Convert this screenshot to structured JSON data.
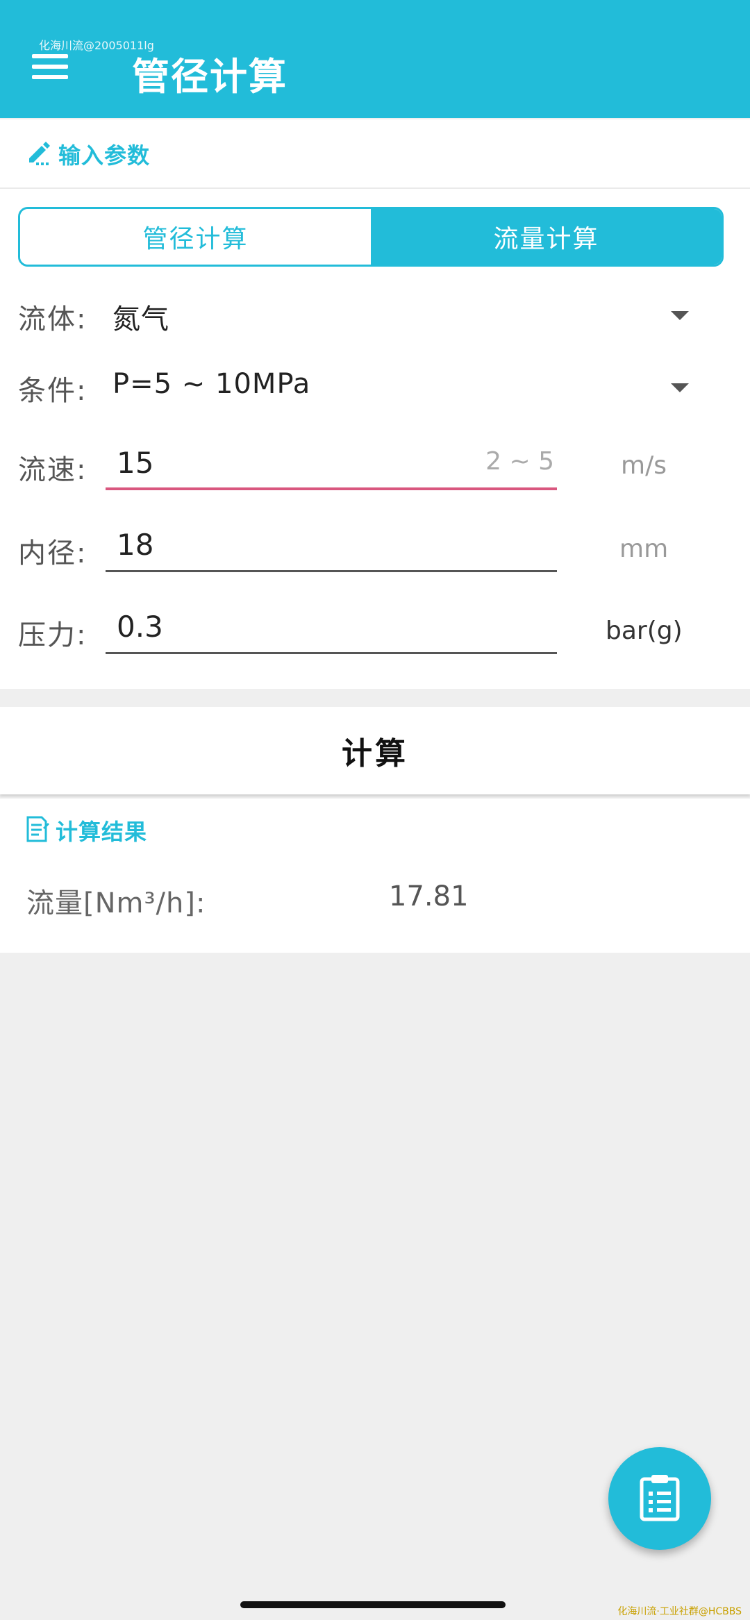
{
  "watermark_top": "化海川流@2005011lg",
  "appbar": {
    "title": "管径计算"
  },
  "input_section": {
    "title": "输入参数"
  },
  "tabs": [
    {
      "label": "管径计算",
      "selected": false
    },
    {
      "label": "流量计算",
      "selected": true
    }
  ],
  "fluid": {
    "label": "流体:",
    "value": "氮气"
  },
  "condition": {
    "label": "条件:",
    "value": "P=5 ~ 10MPa"
  },
  "velocity": {
    "label": "流速:",
    "value": "15",
    "hint": "2 ~ 5",
    "unit": "m/s"
  },
  "inner_diameter": {
    "label": "内径:",
    "value": "18",
    "unit": "mm"
  },
  "pressure": {
    "label": "压力:",
    "value": "0.3",
    "unit": "bar(g)"
  },
  "calculate_button": {
    "label": "计算"
  },
  "result_section": {
    "title": "计算结果"
  },
  "result": {
    "label": "流量[Nm³/h]:",
    "value": "17.81"
  },
  "watermark_bottom": "化海川流·工业社群@HCBBS",
  "colors": {
    "accent": "#22bcd9",
    "focus_underline": "#d9577f"
  },
  "icons": {
    "menu": "menu-icon",
    "edit": "pencil-icon",
    "result": "document-icon",
    "fab": "clipboard-list-icon"
  }
}
